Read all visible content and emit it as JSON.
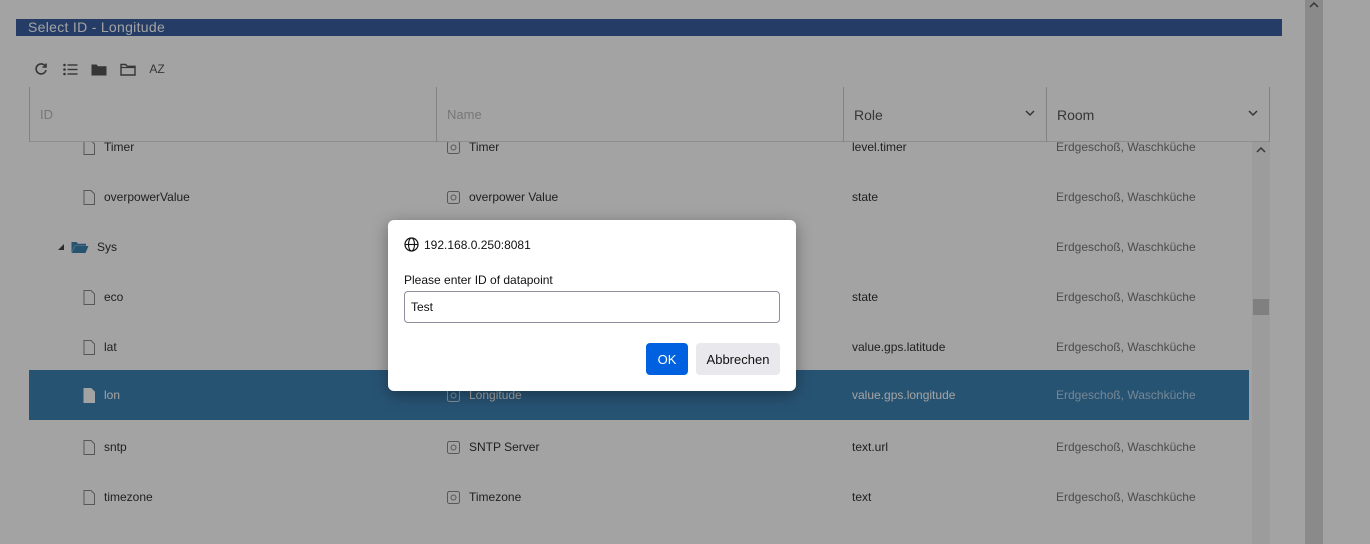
{
  "window": {
    "title": "Select ID - Longitude"
  },
  "toolbar": {
    "sort_label": "AZ"
  },
  "columns": {
    "id_placeholder": "ID",
    "name_placeholder": "Name",
    "role": "Role",
    "room": "Room"
  },
  "rows": [
    {
      "id": "Timer",
      "name": "Timer",
      "role": "level.timer",
      "room": "Erdgeschoß, Waschküche",
      "type": "state"
    },
    {
      "id": "overpowerValue",
      "name": "overpower Value",
      "role": "state",
      "room": "Erdgeschoß, Waschküche",
      "type": "state"
    },
    {
      "id": "Sys",
      "name": "",
      "role": "",
      "room": "Erdgeschoß, Waschküche",
      "type": "folder"
    },
    {
      "id": "eco",
      "name": "",
      "role": "state",
      "room": "Erdgeschoß, Waschküche",
      "type": "state"
    },
    {
      "id": "lat",
      "name": "",
      "role": "value.gps.latitude",
      "room": "Erdgeschoß, Waschküche",
      "type": "state"
    },
    {
      "id": "lon",
      "name": "Longitude",
      "role": "value.gps.longitude",
      "room": "Erdgeschoß, Waschküche",
      "type": "state",
      "selected": true
    },
    {
      "id": "sntp",
      "name": "SNTP Server",
      "role": "text.url",
      "room": "Erdgeschoß, Waschküche",
      "type": "state"
    },
    {
      "id": "timezone",
      "name": "Timezone",
      "role": "text",
      "room": "Erdgeschoß, Waschküche",
      "type": "state"
    }
  ],
  "dialog": {
    "origin": "192.168.0.250:8081",
    "message": "Please enter ID of datapoint",
    "input_value": "Test",
    "ok_label": "OK",
    "cancel_label": "Abbrechen"
  },
  "colors": {
    "titlebar": "#3a5fa0",
    "selected_row": "#3e82b4",
    "ok_button": "#0061e0",
    "folder_icon": "#3e82b4"
  }
}
